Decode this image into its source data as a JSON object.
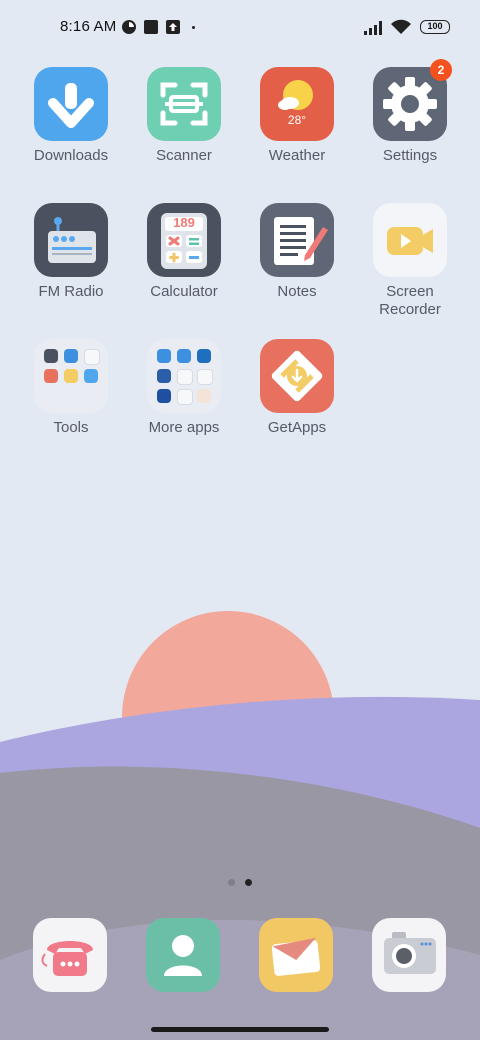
{
  "status_bar": {
    "time": "8:16 AM",
    "battery": "100",
    "icons": [
      "notification-icon-1",
      "notification-icon-2",
      "upload-icon",
      "signal-icon",
      "wifi-icon"
    ]
  },
  "apps": [
    {
      "label": "Downloads",
      "icon": "download-icon",
      "color": "#4fa6ec"
    },
    {
      "label": "Scanner",
      "icon": "scanner-icon",
      "color": "#6fcfb2"
    },
    {
      "label": "Weather",
      "icon": "weather-icon",
      "color": "#e35f48",
      "temp": "28°"
    },
    {
      "label": "Settings",
      "icon": "gear-icon",
      "color": "#5f6676",
      "badge": "2"
    },
    {
      "label": "FM Radio",
      "icon": "radio-icon",
      "color": "#4a5260"
    },
    {
      "label": "Calculator",
      "icon": "calculator-icon",
      "color": "#4a5260",
      "display": "189"
    },
    {
      "label": "Notes",
      "icon": "notes-icon",
      "color": "#5f6676"
    },
    {
      "label": "Screen Recorder",
      "icon": "screen-recorder-icon",
      "color": "#f3f5f9"
    },
    {
      "label": "Tools",
      "icon": "tools-folder-icon",
      "color": "#e9edf3"
    },
    {
      "label": "More apps",
      "icon": "more-apps-folder-icon",
      "color": "#e9edf3"
    },
    {
      "label": "GetApps",
      "icon": "getapps-icon",
      "color": "#e8705f"
    }
  ],
  "page_indicator": {
    "pages": 2,
    "current": 2
  },
  "dock": [
    {
      "icon": "phone-icon",
      "color": "#f4f4f6"
    },
    {
      "icon": "contacts-icon",
      "color": "#6bbfa6"
    },
    {
      "icon": "messages-icon",
      "color": "#f2c865"
    },
    {
      "icon": "camera-icon",
      "color": "#f4f4f6"
    }
  ],
  "colors": {
    "background": "#e3e9f2",
    "sun": "#f2a99b",
    "hill_purple": "#aba6e0",
    "hill_gray": "#9a97a4",
    "label_text": "#555b66"
  }
}
